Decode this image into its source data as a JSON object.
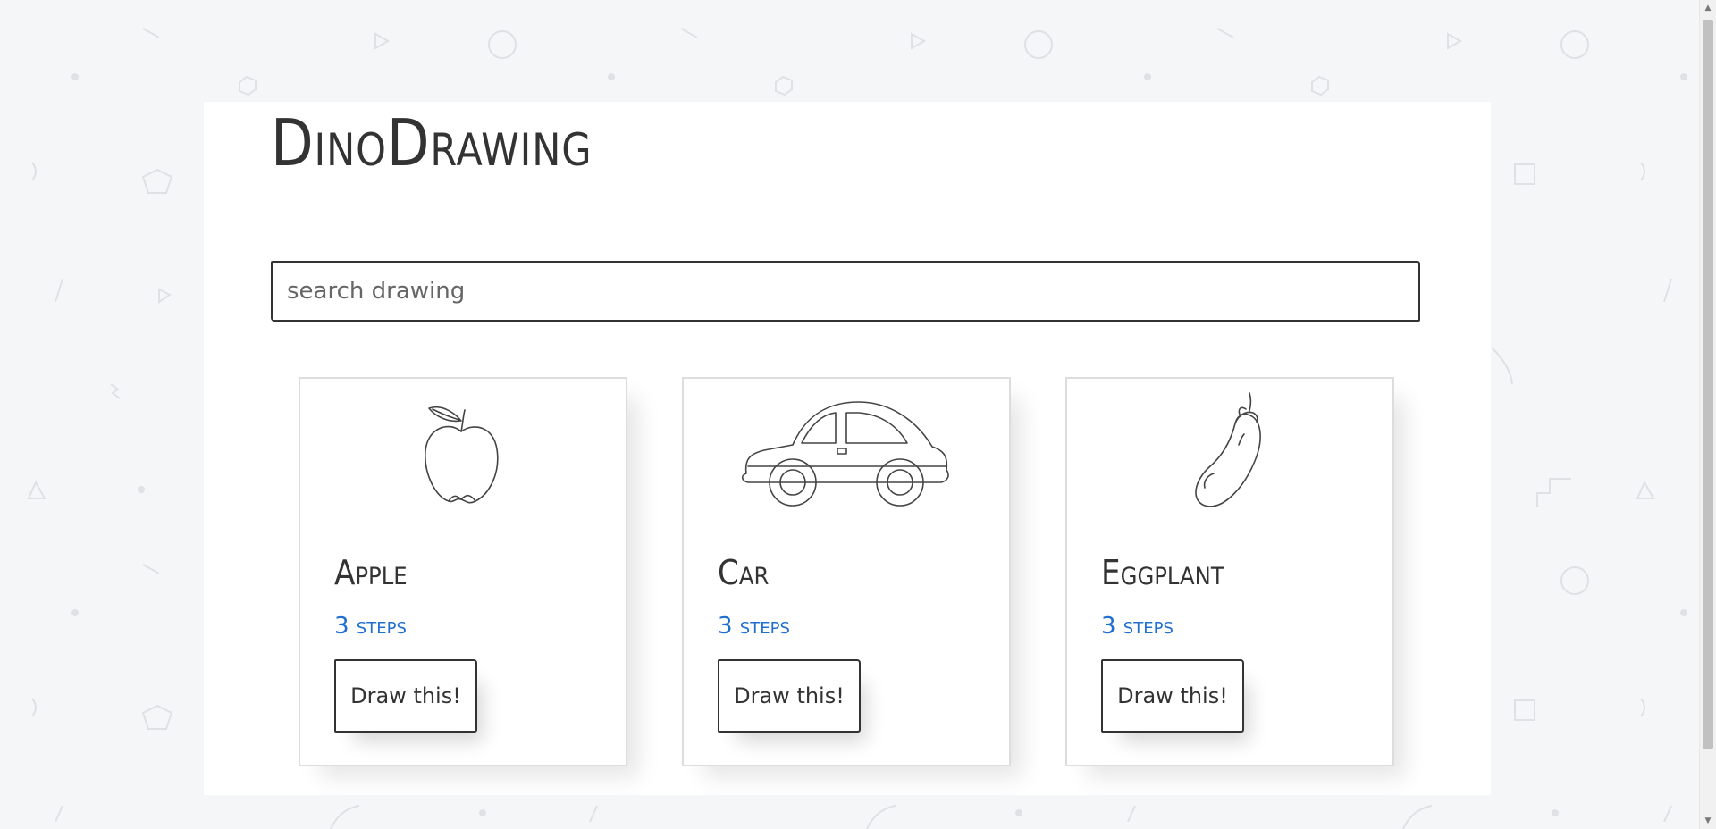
{
  "app": {
    "logo": "DinoDrawing"
  },
  "search": {
    "placeholder": "search drawing",
    "value": ""
  },
  "drawings": [
    {
      "title": "Apple",
      "steps": "3 steps",
      "action": "Draw this!",
      "icon": "apple-icon"
    },
    {
      "title": "Car",
      "steps": "3 steps",
      "action": "Draw this!",
      "icon": "car-icon"
    },
    {
      "title": "Eggplant",
      "steps": "3 steps",
      "action": "Draw this!",
      "icon": "eggplant-icon"
    }
  ],
  "colors": {
    "background": "#f5f6f8",
    "page": "#ffffff",
    "text": "#333333",
    "link": "#1f6fd1",
    "card_border": "#dddddd"
  }
}
